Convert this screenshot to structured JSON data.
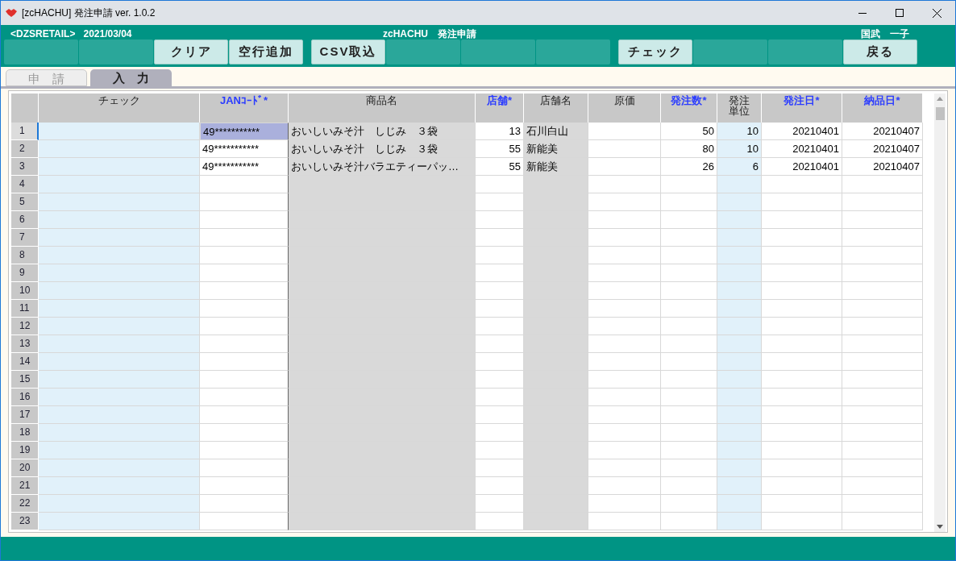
{
  "window": {
    "title": "[zcHACHU] 発注申請 ver. 1.0.2"
  },
  "header": {
    "company": "<DZSRETAIL>",
    "date": "2021/03/04",
    "screen_title": "zcHACHU　発注申請",
    "user": "国武　一子"
  },
  "button_groups": [
    [
      {
        "enabled": false
      },
      {
        "enabled": false
      },
      {
        "enabled": true,
        "label": "クリア"
      },
      {
        "enabled": true,
        "label": "空行追加"
      }
    ],
    [
      {
        "enabled": true,
        "label": "CSV取込"
      },
      {
        "enabled": false
      },
      {
        "enabled": false
      },
      {
        "enabled": false
      }
    ],
    [
      {
        "enabled": true,
        "label": "チェック"
      },
      {
        "enabled": false
      },
      {
        "enabled": false
      },
      {
        "enabled": true,
        "label": "戻る"
      }
    ]
  ],
  "tabs": [
    {
      "label": "申　請",
      "selected": false
    },
    {
      "label": "入　力",
      "selected": true
    }
  ],
  "table": {
    "columns": [
      {
        "label": "チェック",
        "required": false
      },
      {
        "label": "JANｺｰﾄﾞ*",
        "required": true
      },
      {
        "label": "商品名",
        "required": false
      },
      {
        "label": "店舗*",
        "required": true
      },
      {
        "label": "店舗名",
        "required": false
      },
      {
        "label": "原価",
        "required": false
      },
      {
        "label": "発注数*",
        "required": true
      },
      {
        "label": "発注単位",
        "required": false
      },
      {
        "label": "発注日*",
        "required": true
      },
      {
        "label": "納品日*",
        "required": true
      }
    ],
    "rows": [
      {
        "number": "1",
        "selected": true,
        "cells": [
          null,
          "49***********",
          "おいしいみそ汁　しじみ　３袋",
          "13",
          "石川白山",
          null,
          "50",
          "10",
          "20210401",
          "20210407"
        ]
      },
      {
        "number": "2",
        "selected": false,
        "cells": [
          null,
          "49***********",
          "おいしいみそ汁　しじみ　３袋",
          "55",
          "新能美",
          null,
          "80",
          "10",
          "20210401",
          "20210407"
        ]
      },
      {
        "number": "3",
        "selected": false,
        "cells": [
          null,
          "49***********",
          "おいしいみそ汁バラエティーパッ…",
          "55",
          "新能美",
          null,
          "26",
          "6",
          "20210401",
          "20210407"
        ]
      },
      {
        "number": "4",
        "selected": false
      },
      {
        "number": "5",
        "selected": false
      },
      {
        "number": "6",
        "selected": false
      },
      {
        "number": "7",
        "selected": false
      },
      {
        "number": "8",
        "selected": false
      },
      {
        "number": "9",
        "selected": false
      },
      {
        "number": "10",
        "selected": false
      },
      {
        "number": "11",
        "selected": false
      },
      {
        "number": "12",
        "selected": false
      },
      {
        "number": "13",
        "selected": false
      },
      {
        "number": "14",
        "selected": false
      },
      {
        "number": "15",
        "selected": false
      },
      {
        "number": "16",
        "selected": false
      },
      {
        "number": "17",
        "selected": false
      },
      {
        "number": "18",
        "selected": false
      },
      {
        "number": "19",
        "selected": false
      },
      {
        "number": "20",
        "selected": false
      },
      {
        "number": "21",
        "selected": false
      },
      {
        "number": "22",
        "selected": false
      },
      {
        "number": "23",
        "selected": false
      }
    ]
  }
}
